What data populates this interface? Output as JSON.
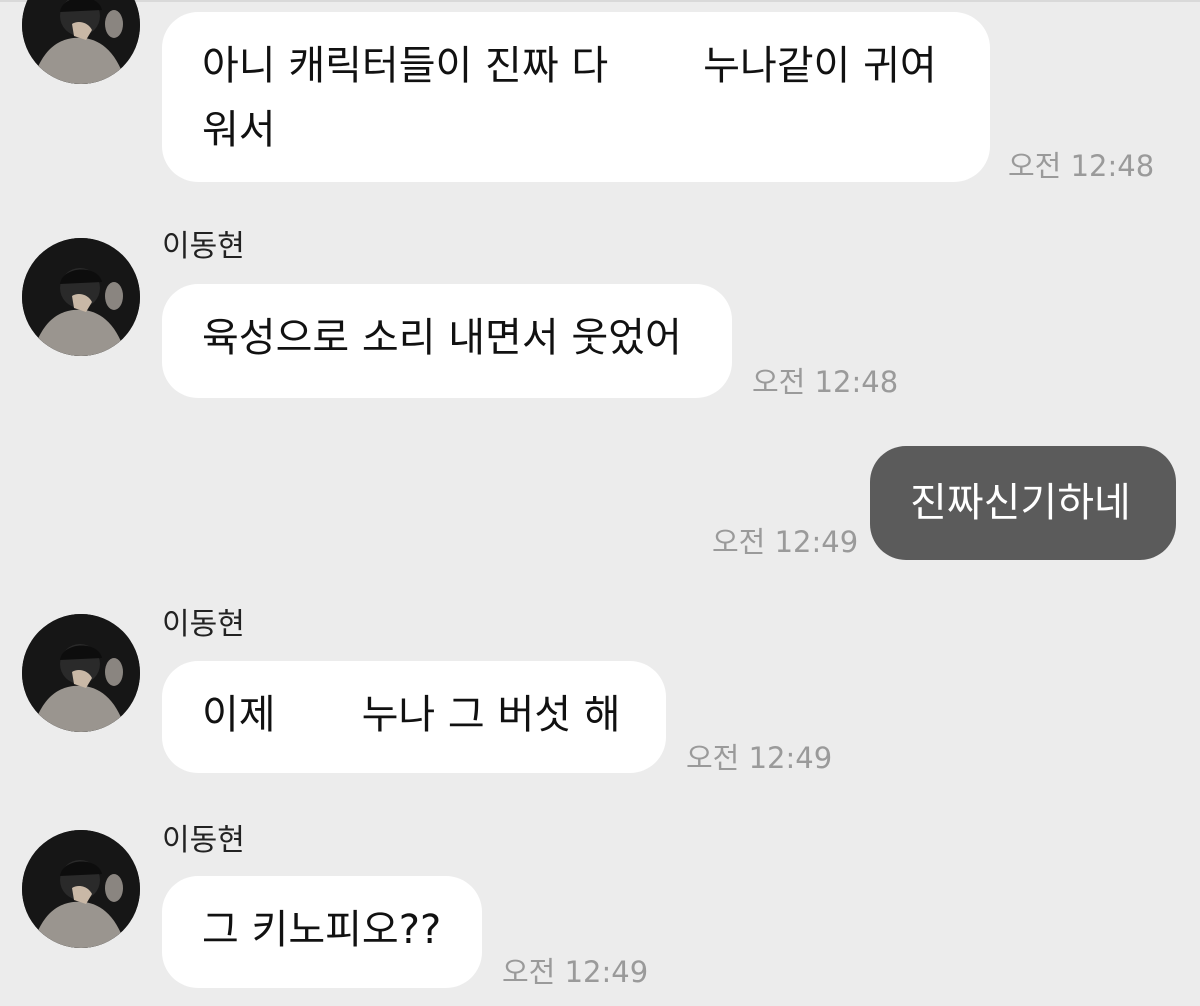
{
  "messages": [
    {
      "sender": "",
      "parts": [
        "아니 캐릭터들이 진짜 다",
        "누나같이 귀여",
        "워서"
      ],
      "time": "오전 12:48",
      "direction": "incoming"
    },
    {
      "sender": "이동현",
      "parts": [
        "육성으로 소리 내면서 웃었어"
      ],
      "time": "오전 12:48",
      "direction": "incoming"
    },
    {
      "sender": "",
      "parts": [
        "진짜신기하네"
      ],
      "time": "오전 12:49",
      "direction": "outgoing"
    },
    {
      "sender": "이동현",
      "parts": [
        "이제",
        "누나 그 버섯 해"
      ],
      "time": "오전 12:49",
      "direction": "incoming"
    },
    {
      "sender": "이동현",
      "parts": [
        "그 키노피오??"
      ],
      "time": "오전 12:49",
      "direction": "incoming"
    }
  ],
  "colors": {
    "background": "#ececec",
    "incoming_bubble": "#ffffff",
    "outgoing_bubble": "#5b5b5b",
    "time_text": "#9a9a9a"
  },
  "icons": [
    "avatar-photo"
  ]
}
